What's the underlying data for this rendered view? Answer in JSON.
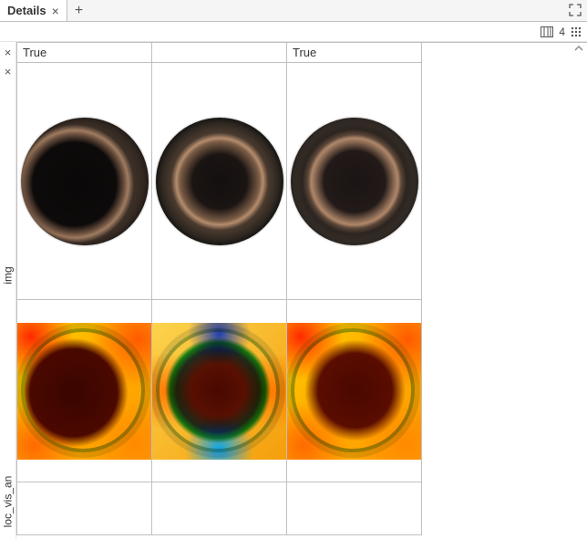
{
  "tab": {
    "title": "Details"
  },
  "toolbar": {
    "column_count": "4"
  },
  "gutter": {
    "row_labels": {
      "img": "img",
      "loc": "loc_vis_an"
    }
  },
  "grid": {
    "headers": [
      "True",
      "",
      "True"
    ]
  }
}
